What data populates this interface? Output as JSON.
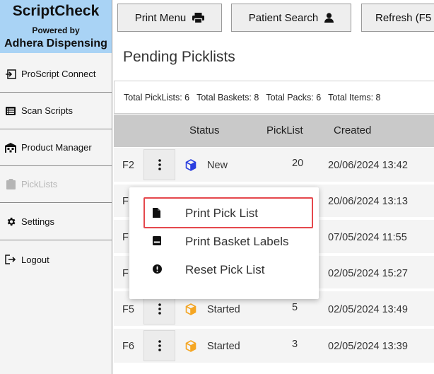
{
  "brand": {
    "name": "ScriptCheck",
    "powered_by": "Powered by",
    "company": "Adhera Dispensing",
    "bg_color": "#a9d3f5"
  },
  "sidebar": {
    "items": [
      {
        "label": "ProScript Connect",
        "icon": "login-arrow-icon",
        "enabled": true
      },
      {
        "label": "Scan Scripts",
        "icon": "list-icon",
        "enabled": true
      },
      {
        "label": "Product Manager",
        "icon": "warehouse-icon",
        "enabled": true
      },
      {
        "label": "PickLists",
        "icon": "clipboard-icon",
        "enabled": false
      },
      {
        "label": "Settings",
        "icon": "gear-icon",
        "enabled": true
      },
      {
        "label": "Logout",
        "icon": "logout-icon",
        "enabled": true
      }
    ]
  },
  "toolbar": {
    "print_menu": "Print Menu",
    "patient_search": "Patient Search",
    "refresh": "Refresh (F5"
  },
  "page": {
    "title": "Pending Picklists"
  },
  "totals": {
    "picklists": "Total PickLists: 6",
    "baskets": "Total Baskets: 8",
    "packs": "Total Packs: 6",
    "items": "Total Items: 8"
  },
  "table": {
    "headers": {
      "status": "Status",
      "picklist": "PickList",
      "created": "Created"
    },
    "rows": [
      {
        "fkey": "F2",
        "status": "New",
        "status_icon": "cube-icon-blue",
        "picklist": "20",
        "created": "20/06/2024 13:42"
      },
      {
        "fkey": "F",
        "status": "",
        "status_icon": "",
        "picklist": "",
        "created": "20/06/2024 13:13"
      },
      {
        "fkey": "F",
        "status": "",
        "status_icon": "",
        "picklist": "",
        "created": "07/05/2024 11:55"
      },
      {
        "fkey": "F",
        "status": "",
        "status_icon": "",
        "picklist": "",
        "created": "02/05/2024 15:27"
      },
      {
        "fkey": "F5",
        "status": "Started",
        "status_icon": "cube-icon-orange",
        "picklist": "5",
        "created": "02/05/2024 13:49"
      },
      {
        "fkey": "F6",
        "status": "Started",
        "status_icon": "cube-icon-orange",
        "picklist": "3",
        "created": "02/05/2024 13:39"
      }
    ]
  },
  "menu": {
    "items": [
      {
        "label": "Print Pick List",
        "icon": "document-icon",
        "highlighted": true
      },
      {
        "label": "Print Basket Labels",
        "icon": "label-icon",
        "highlighted": false
      },
      {
        "label": "Reset Pick List",
        "icon": "alert-icon",
        "highlighted": false
      }
    ],
    "highlight_color": "#e5484d"
  },
  "colors": {
    "new_status": "#2b3fe0",
    "started_status": "#f5a623"
  }
}
